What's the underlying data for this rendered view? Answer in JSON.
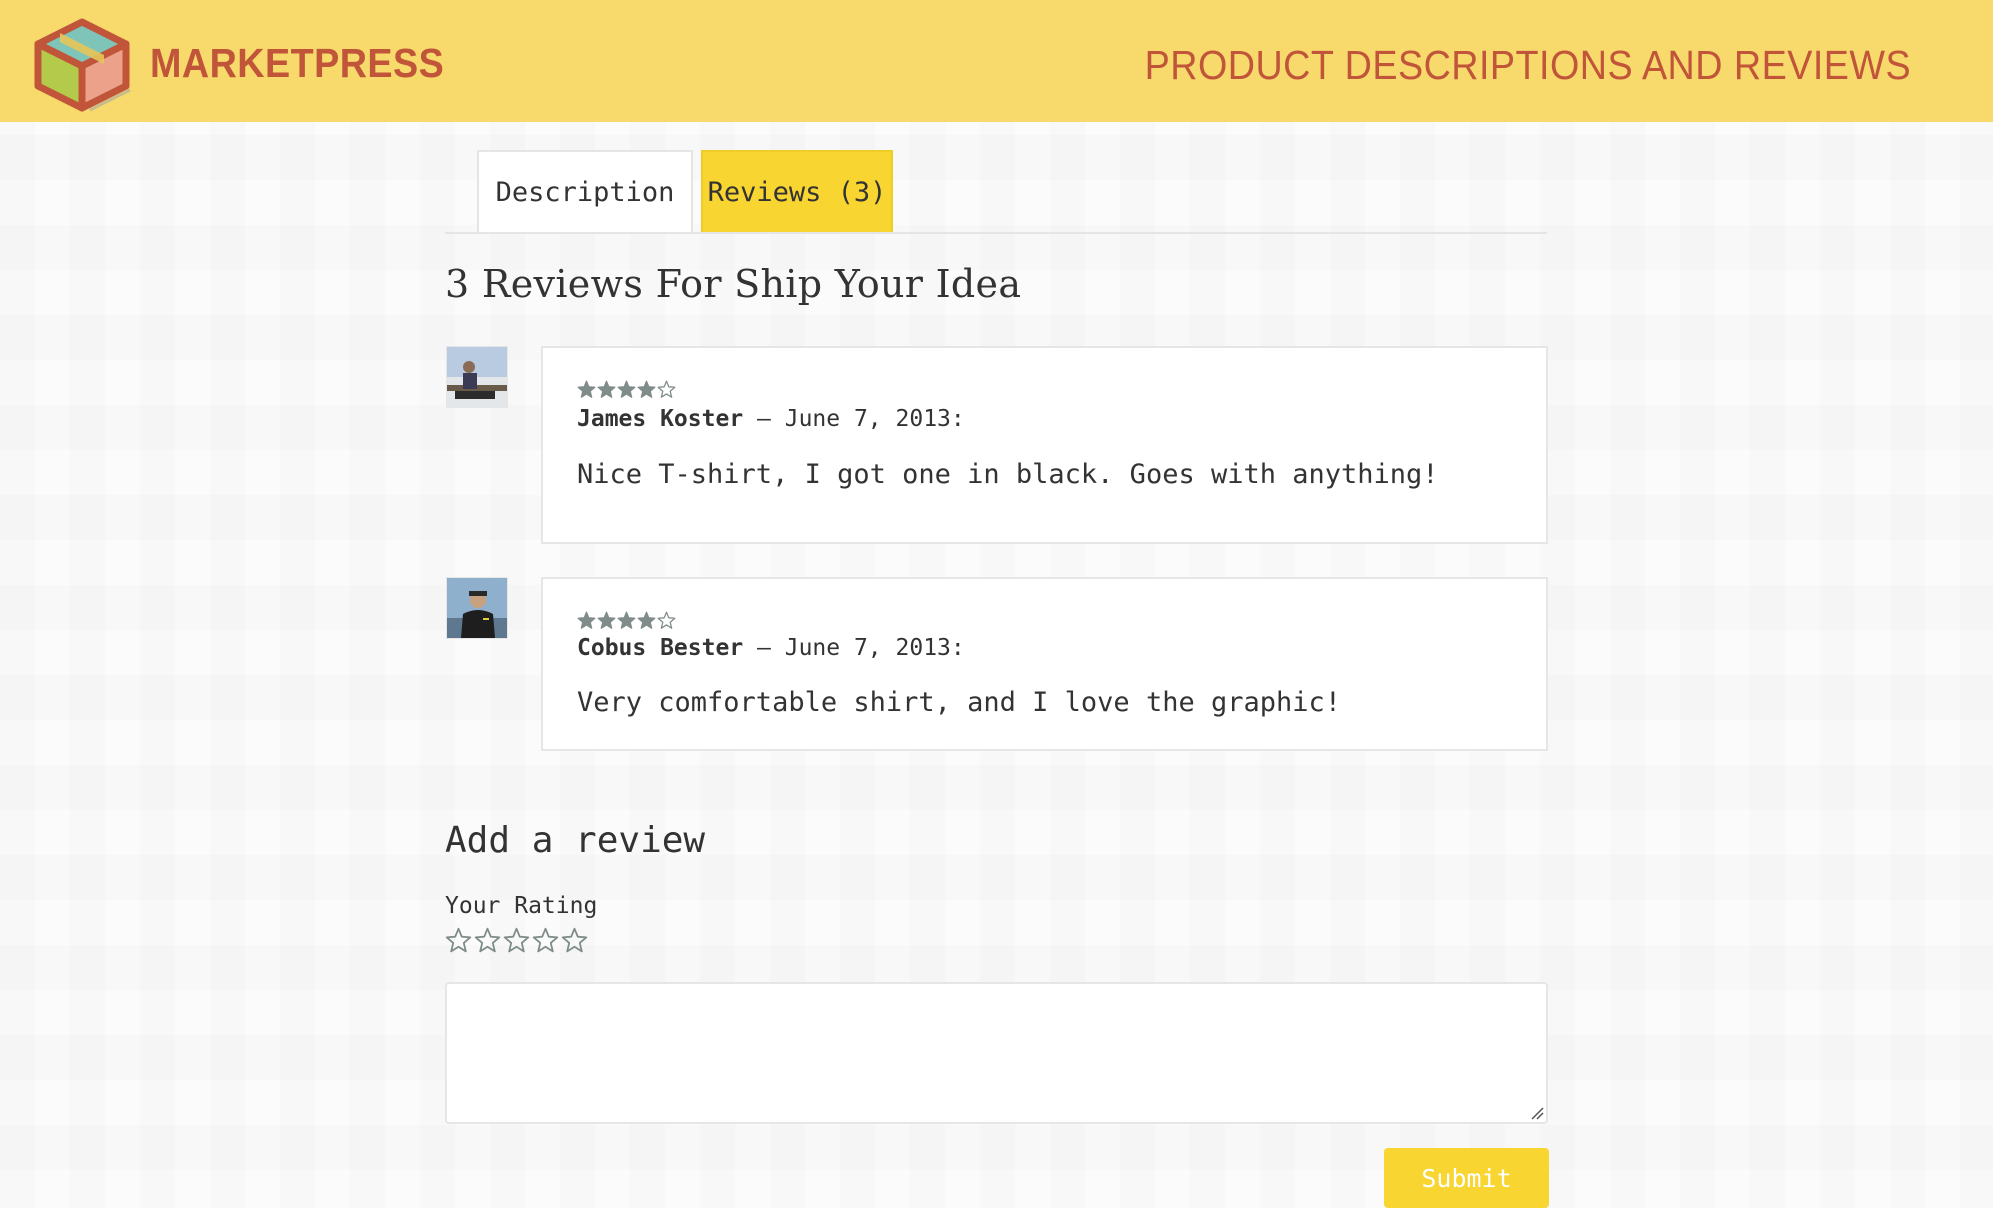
{
  "header": {
    "brand": "MARKETPRESS",
    "tagline": "PRODUCT DESCRIPTIONS AND REVIEWS",
    "background_color": "#f7d96c",
    "brand_color": "#c0553a",
    "logo_icon": "cube-box-icon"
  },
  "tabs": [
    {
      "label": "Description",
      "active": false
    },
    {
      "label": "Reviews (3)",
      "active": true
    }
  ],
  "reviews_heading": "3 Reviews For Ship Your Idea",
  "reviews": [
    {
      "author": "James Koster",
      "date": "– June 7, 2013:",
      "rating": 4,
      "max_rating": 5,
      "text": "Nice T-shirt, I got one in black. Goes with anything!",
      "avatar": "user-avatar-1"
    },
    {
      "author": "Cobus Bester",
      "date": "– June 7, 2013:",
      "rating": 4,
      "max_rating": 5,
      "text": "Very comfortable shirt, and I love the graphic!",
      "avatar": "user-avatar-2"
    }
  ],
  "add_review": {
    "heading": "Add a review",
    "rating_label": "Your Rating",
    "rating_value": 0,
    "rating_max": 5,
    "textarea_value": "",
    "submit_label": "Submit"
  },
  "colors": {
    "accent": "#f8d530",
    "star": "#7f8c8a",
    "border": "#e6e6e6"
  }
}
